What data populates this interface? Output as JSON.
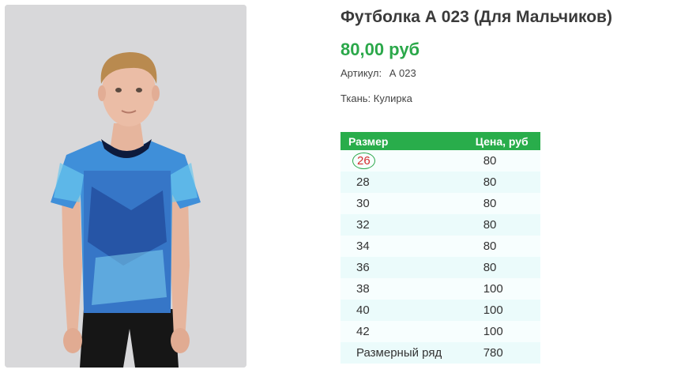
{
  "product": {
    "title": "Футболка А 023 (Для Мальчиков)",
    "price": "80,00 руб",
    "article_label": "Артикул:",
    "article_value": "А 023",
    "fabric": "Ткань: Кулирка",
    "image_icon": "product-photo-boy-in-blue-print-tshirt"
  },
  "table": {
    "headers": [
      "Размер",
      "Цена, руб"
    ],
    "rows": [
      {
        "size": "26",
        "price": "80"
      },
      {
        "size": "28",
        "price": "80"
      },
      {
        "size": "30",
        "price": "80"
      },
      {
        "size": "32",
        "price": "80"
      },
      {
        "size": "34",
        "price": "80"
      },
      {
        "size": "36",
        "price": "80"
      },
      {
        "size": "38",
        "price": "100"
      },
      {
        "size": "40",
        "price": "100"
      },
      {
        "size": "42",
        "price": "100"
      },
      {
        "size": "Размерный ряд",
        "price": "780"
      }
    ]
  },
  "colors": {
    "accent_green": "#29ad4b",
    "price_green": "#2ba84a",
    "highlight_red": "#d42b2b"
  }
}
